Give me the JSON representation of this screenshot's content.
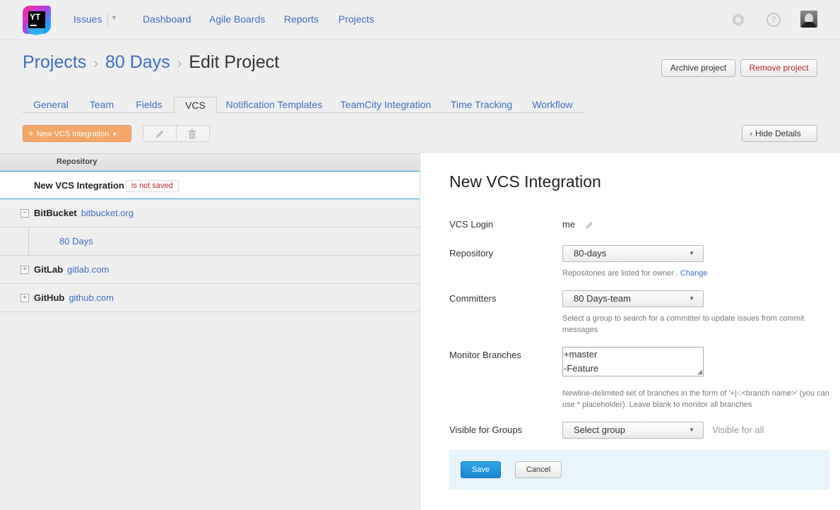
{
  "header": {
    "logo_text": "YT",
    "nav": {
      "issues": "Issues",
      "dashboard": "Dashboard",
      "agile_boards": "Agile Boards",
      "reports": "Reports",
      "projects": "Projects"
    },
    "help_glyph": "?"
  },
  "breadcrumb": {
    "root": "Projects",
    "project": "80 Days",
    "current": "Edit Project"
  },
  "actions": {
    "archive": "Archive project",
    "remove": "Remove project"
  },
  "tabs": [
    "General",
    "Team",
    "Fields",
    "VCS",
    "Notification Templates",
    "TeamCity Integration",
    "Time Tracking",
    "Workflow"
  ],
  "active_tab": "VCS",
  "toolbar": {
    "new_integration": "New VCS Integration",
    "hide_details": "Hide Details"
  },
  "list": {
    "header": "Repository",
    "selected": {
      "name": "New VCS Integration",
      "badge": "is not saved"
    },
    "groups": [
      {
        "name": "BitBucket",
        "host": "bitbucket.org",
        "expanded": true,
        "toggle": "−",
        "children": [
          "80 Days"
        ]
      },
      {
        "name": "GitLab",
        "host": "gitlab.com",
        "expanded": false,
        "toggle": "+"
      },
      {
        "name": "GitHub",
        "host": "github.com",
        "expanded": false,
        "toggle": "+"
      }
    ]
  },
  "detail": {
    "title": "New VCS Integration",
    "vcs_login": {
      "label": "VCS Login",
      "value": "me"
    },
    "repository": {
      "label": "Repository",
      "value": "80-days",
      "hint": "Repositories are listed for owner .",
      "hint_link": "Change"
    },
    "committers": {
      "label": "Committers",
      "value": "80 Days-team",
      "hint": "Select a group to search for a committer to update issues from commit messages"
    },
    "monitor_branches": {
      "label": "Monitor Branches",
      "lines": [
        "+master",
        "-Feature"
      ],
      "hint": "Newline-delimited set of branches in the form of '+|-:<branch name>' (you can use * placeholder). Leave blank to monitor all branches"
    },
    "visible_for_groups": {
      "label": "Visible for Groups",
      "value": "Select group",
      "note": "Visible for all"
    },
    "save": "Save",
    "cancel": "Cancel"
  },
  "colors": {
    "link": "#3d6fbf",
    "accent_orange": "#f5a66a",
    "save_blue": "#1b86cf",
    "danger": "#b52a2a",
    "footer_bg": "#e8f5fc"
  },
  "icons": [
    "youtrack-logo-icon",
    "dropdown-caret-icon",
    "gear-icon",
    "help-icon",
    "avatar",
    "plus-icon",
    "pencil-icon",
    "trash-icon",
    "chevron-right-icon",
    "expand-toggle-icon",
    "collapse-toggle-icon"
  ]
}
